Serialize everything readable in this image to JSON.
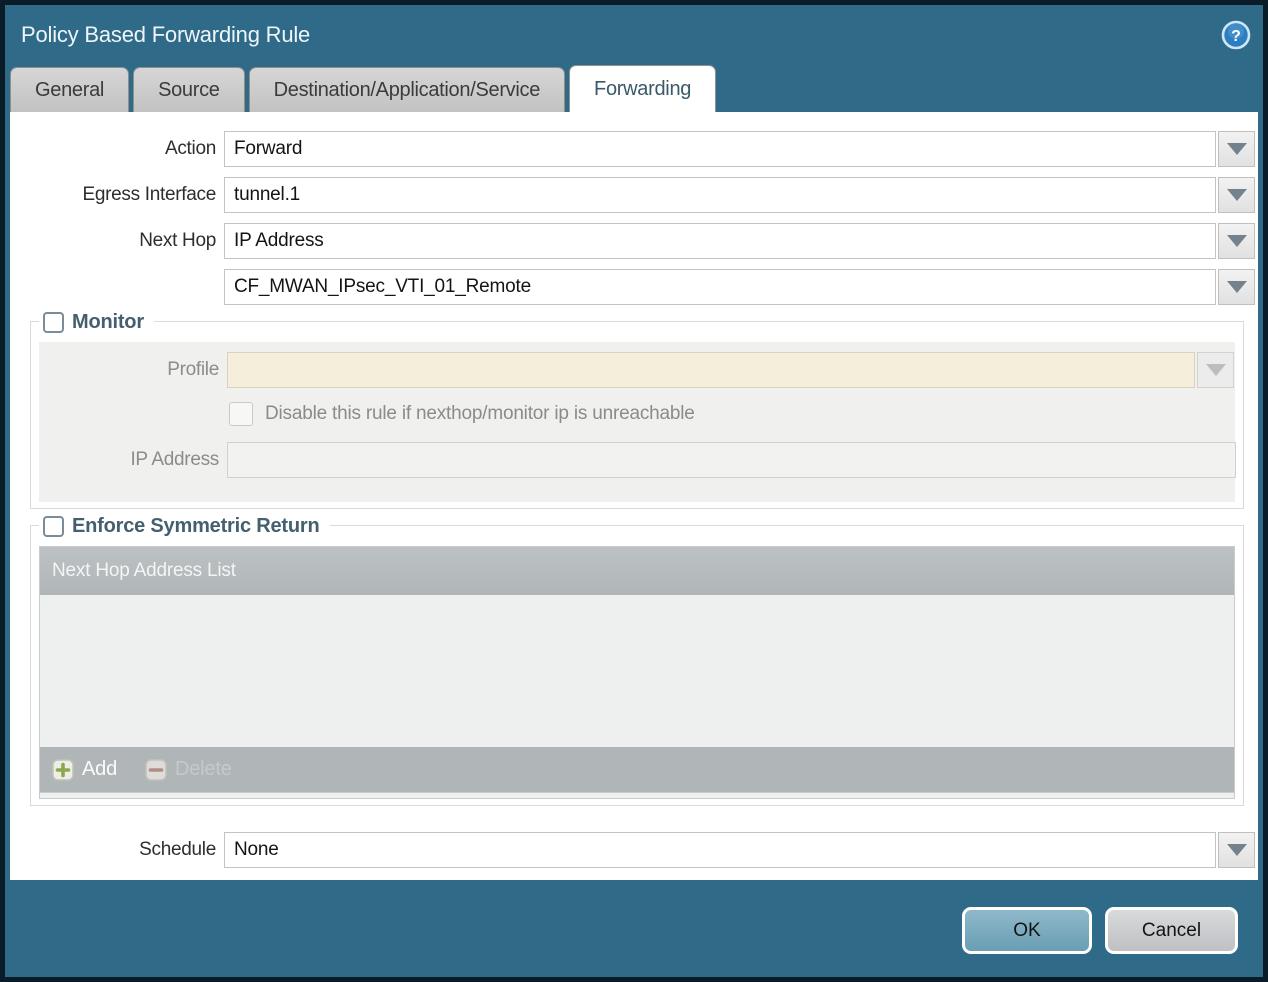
{
  "window": {
    "title": "Policy Based Forwarding Rule",
    "help_glyph": "?"
  },
  "tabs": [
    {
      "label": "General",
      "active": false
    },
    {
      "label": "Source",
      "active": false
    },
    {
      "label": "Destination/Application/Service",
      "active": false
    },
    {
      "label": "Forwarding",
      "active": true
    }
  ],
  "form": {
    "action": {
      "label": "Action",
      "value": "Forward"
    },
    "egress_interface": {
      "label": "Egress Interface",
      "value": "tunnel.1"
    },
    "next_hop": {
      "label": "Next Hop",
      "value": "IP Address"
    },
    "next_hop_address": {
      "value": "CF_MWAN_IPsec_VTI_01_Remote"
    },
    "schedule": {
      "label": "Schedule",
      "value": "None"
    }
  },
  "monitor": {
    "legend": "Monitor",
    "checked": false,
    "profile": {
      "label": "Profile",
      "value": ""
    },
    "disable_rule": {
      "label": "Disable this rule if nexthop/monitor ip is unreachable",
      "checked": false
    },
    "ip_address": {
      "label": "IP Address",
      "value": ""
    }
  },
  "enforce_symmetric_return": {
    "legend": "Enforce Symmetric Return",
    "checked": false,
    "table": {
      "header": "Next Hop Address List",
      "rows": []
    },
    "add_label": "Add",
    "delete_label": "Delete"
  },
  "footer": {
    "ok_label": "OK",
    "cancel_label": "Cancel"
  },
  "colors": {
    "titlebar_teal": "#2f6b88",
    "window_border": "#0b1c29",
    "legend_slate": "#44606f",
    "profile_field_beige": "#f5eedb",
    "table_header_gray": "#b4b9bc",
    "table_body_gray": "#eef0f0",
    "ok_button_blue": "#7dabc0",
    "cancel_button_gray": "#c9cbce",
    "add_icon_green": "#8ca84e",
    "delete_icon_red": "#b08276"
  }
}
